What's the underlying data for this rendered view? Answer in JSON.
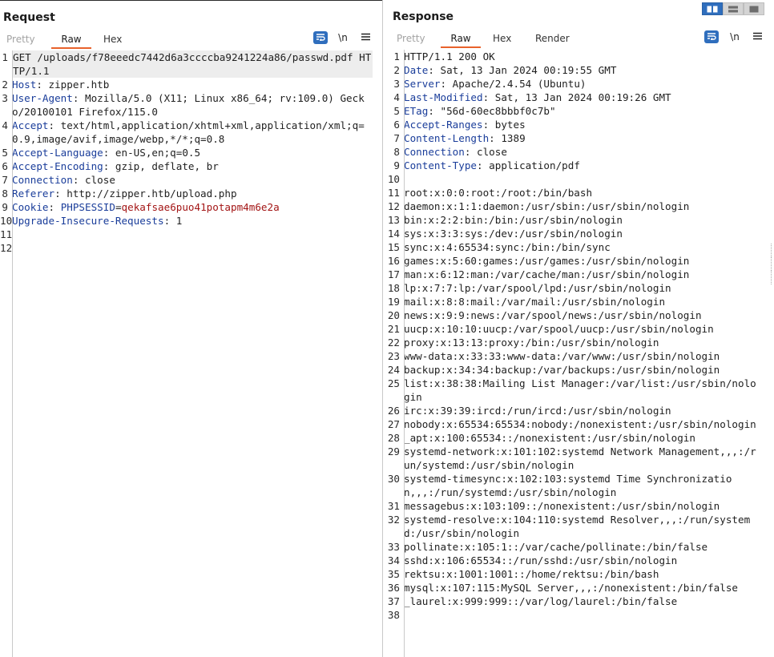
{
  "request": {
    "title": "Request",
    "tabs": [
      "Pretty",
      "Raw",
      "Hex"
    ],
    "active_tab": "Raw",
    "lines": [
      {
        "n": "1",
        "text": "GET /uploads/f78eeedc7442d6a3ccccba9241224a86/passwd.pdf HTTP/1.1"
      },
      {
        "n": "2",
        "key": "Host",
        "value": " zipper.htb"
      },
      {
        "n": "3",
        "key": "User-Agent",
        "value": " Mozilla/5.0 (X11; Linux x86_64; rv:109.0) Gecko/20100101 Firefox/115.0"
      },
      {
        "n": "4",
        "key": "Accept",
        "value": " text/html,application/xhtml+xml,application/xml;q=0.9,image/avif,image/webp,*/*;q=0.8"
      },
      {
        "n": "5",
        "key": "Accept-Language",
        "value": " en-US,en;q=0.5"
      },
      {
        "n": "6",
        "key": "Accept-Encoding",
        "value": " gzip, deflate, br"
      },
      {
        "n": "7",
        "key": "Connection",
        "value": " close"
      },
      {
        "n": "8",
        "key": "Referer",
        "value": " http://zipper.htb/upload.php"
      },
      {
        "n": "9",
        "key": "Cookie",
        "cookie_name": "PHPSESSID",
        "cookie_value": "qekafsae6puo41potapm4m6e2a"
      },
      {
        "n": "10",
        "key": "Upgrade-Insecure-Requests",
        "value": " 1"
      },
      {
        "n": "11",
        "text": ""
      },
      {
        "n": "12",
        "text": ""
      }
    ]
  },
  "response": {
    "title": "Response",
    "tabs": [
      "Pretty",
      "Raw",
      "Hex",
      "Render"
    ],
    "active_tab": "Raw",
    "lines": [
      {
        "n": "1",
        "text": "HTTP/1.1 200 OK"
      },
      {
        "n": "2",
        "key": "Date",
        "value": " Sat, 13 Jan 2024 00:19:55 GMT"
      },
      {
        "n": "3",
        "key": "Server",
        "value": " Apache/2.4.54 (Ubuntu)"
      },
      {
        "n": "4",
        "key": "Last-Modified",
        "value": " Sat, 13 Jan 2024 00:19:26 GMT"
      },
      {
        "n": "5",
        "key": "ETag",
        "value": " \"56d-60ec8bbbf0c7b\""
      },
      {
        "n": "6",
        "key": "Accept-Ranges",
        "value": " bytes"
      },
      {
        "n": "7",
        "key": "Content-Length",
        "value": " 1389"
      },
      {
        "n": "8",
        "key": "Connection",
        "value": " close"
      },
      {
        "n": "9",
        "key": "Content-Type",
        "value": " application/pdf"
      },
      {
        "n": "10",
        "text": ""
      },
      {
        "n": "11",
        "text": "root:x:0:0:root:/root:/bin/bash"
      },
      {
        "n": "12",
        "text": "daemon:x:1:1:daemon:/usr/sbin:/usr/sbin/nologin"
      },
      {
        "n": "13",
        "text": "bin:x:2:2:bin:/bin:/usr/sbin/nologin"
      },
      {
        "n": "14",
        "text": "sys:x:3:3:sys:/dev:/usr/sbin/nologin"
      },
      {
        "n": "15",
        "text": "sync:x:4:65534:sync:/bin:/bin/sync"
      },
      {
        "n": "16",
        "text": "games:x:5:60:games:/usr/games:/usr/sbin/nologin"
      },
      {
        "n": "17",
        "text": "man:x:6:12:man:/var/cache/man:/usr/sbin/nologin"
      },
      {
        "n": "18",
        "text": "lp:x:7:7:lp:/var/spool/lpd:/usr/sbin/nologin"
      },
      {
        "n": "19",
        "text": "mail:x:8:8:mail:/var/mail:/usr/sbin/nologin"
      },
      {
        "n": "20",
        "text": "news:x:9:9:news:/var/spool/news:/usr/sbin/nologin"
      },
      {
        "n": "21",
        "text": "uucp:x:10:10:uucp:/var/spool/uucp:/usr/sbin/nologin"
      },
      {
        "n": "22",
        "text": "proxy:x:13:13:proxy:/bin:/usr/sbin/nologin"
      },
      {
        "n": "23",
        "text": "www-data:x:33:33:www-data:/var/www:/usr/sbin/nologin"
      },
      {
        "n": "24",
        "text": "backup:x:34:34:backup:/var/backups:/usr/sbin/nologin"
      },
      {
        "n": "25",
        "text": "list:x:38:38:Mailing List Manager:/var/list:/usr/sbin/nologin"
      },
      {
        "n": "26",
        "text": "irc:x:39:39:ircd:/run/ircd:/usr/sbin/nologin"
      },
      {
        "n": "27",
        "text": "nobody:x:65534:65534:nobody:/nonexistent:/usr/sbin/nologin"
      },
      {
        "n": "28",
        "text": "_apt:x:100:65534::/nonexistent:/usr/sbin/nologin"
      },
      {
        "n": "29",
        "text": "systemd-network:x:101:102:systemd Network Management,,,:/run/systemd:/usr/sbin/nologin"
      },
      {
        "n": "30",
        "text": "systemd-timesync:x:102:103:systemd Time Synchronization,,,:/run/systemd:/usr/sbin/nologin"
      },
      {
        "n": "31",
        "text": "messagebus:x:103:109::/nonexistent:/usr/sbin/nologin"
      },
      {
        "n": "32",
        "text": "systemd-resolve:x:104:110:systemd Resolver,,,:/run/systemd:/usr/sbin/nologin"
      },
      {
        "n": "33",
        "text": "pollinate:x:105:1::/var/cache/pollinate:/bin/false"
      },
      {
        "n": "34",
        "text": "sshd:x:106:65534::/run/sshd:/usr/sbin/nologin"
      },
      {
        "n": "35",
        "text": "rektsu:x:1001:1001::/home/rektsu:/bin/bash"
      },
      {
        "n": "36",
        "text": "mysql:x:107:115:MySQL Server,,,:/nonexistent:/bin/false"
      },
      {
        "n": "37",
        "text": "_laurel:x:999:999::/var/log/laurel:/bin/false"
      },
      {
        "n": "38",
        "text": ""
      }
    ]
  },
  "toolbar": {
    "wrap_icon": "wrap-lines-icon",
    "newline_label": "\\n",
    "menu_icon": "hamburger-menu-icon"
  },
  "view_toggle": {
    "icons": [
      "side-by-side-icon",
      "stacked-horizontal-icon",
      "tabbed-view-icon"
    ],
    "active": "side-by-side-icon"
  },
  "colors": {
    "header_key": "#1a3d9a",
    "cookie_value": "#a31515",
    "active_tab_underline": "#e8622c",
    "accent_blue": "#2f6ebd"
  }
}
